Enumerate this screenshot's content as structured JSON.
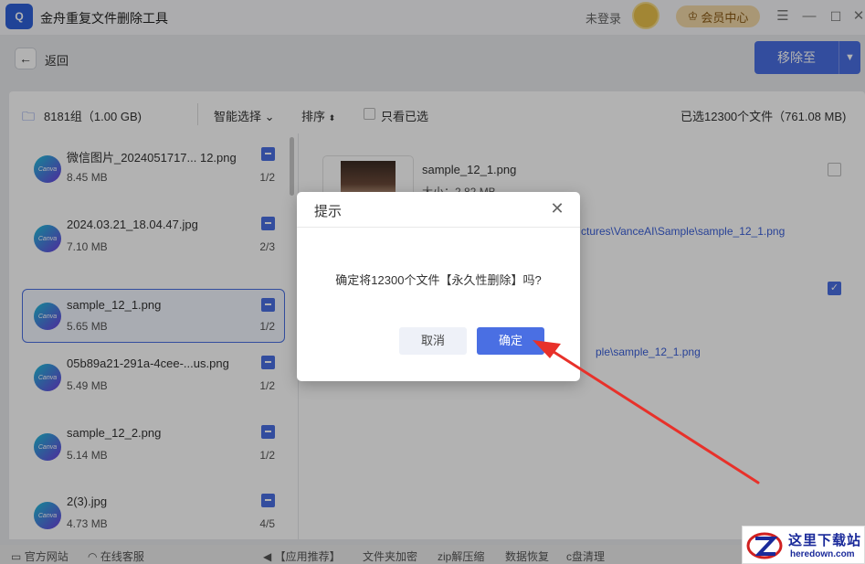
{
  "app": {
    "logo_text": "Q",
    "title": "金舟重复文件删除工具",
    "login_label": "未登录",
    "vip_label": "会员中心",
    "window_controls": [
      "menu-icon",
      "minimize-icon",
      "maximize-icon",
      "close-icon"
    ]
  },
  "toolbar": {
    "back_label": "返回",
    "move_to_label": "移除至"
  },
  "filter_bar": {
    "group_label": "8181组（1.00 GB)",
    "smart_select_label": "智能选择",
    "sort_label": "排序",
    "only_selected_label": "只看已选",
    "selected_summary": "已选12300个文件（761.08 MB)"
  },
  "groups": [
    {
      "name": "微信图片_2024051717... 12.png",
      "size": "8.45 MB",
      "count": "1/2",
      "selected": false
    },
    {
      "name": "2024.03.21_18.04.47.jpg",
      "size": "7.10 MB",
      "count": "2/3",
      "selected": false
    },
    {
      "name": "sample_12_1.png",
      "size": "5.65 MB",
      "count": "1/2",
      "selected": true
    },
    {
      "name": "05b89a21-291a-4cee-...us.png",
      "size": "5.49 MB",
      "count": "1/2",
      "selected": false
    },
    {
      "name": "sample_12_2.png",
      "size": "5.14 MB",
      "count": "1/2",
      "selected": false
    },
    {
      "name": "2(3).jpg",
      "size": "4.73 MB",
      "count": "4/5",
      "selected": false
    }
  ],
  "canva_label": "Canva",
  "detail": {
    "file_name": "sample_12_1.png",
    "size_fragment": "大小：2.82 MB",
    "path_fragment_1": "ctures\\VanceAI\\Sample\\sample_12_1.png",
    "path_fragment_2": "ple\\sample_12_1.png"
  },
  "dialog": {
    "title": "提示",
    "message": "确定将12300个文件【永久性删除】吗?",
    "cancel_label": "取消",
    "confirm_label": "确定"
  },
  "footer": {
    "website": "官方网站",
    "support": "在线客服",
    "promo_label": "【应用推荐】",
    "links": [
      "文件夹加密",
      "zip解压缩",
      "数据恢复",
      "c盘清理"
    ]
  },
  "watermark": {
    "title": "这里下载站",
    "domain": "heredown.com"
  },
  "colors": {
    "accent": "#4a6fe3",
    "arrow": "#e8312a",
    "vip_bg": "#f2d9a8"
  }
}
